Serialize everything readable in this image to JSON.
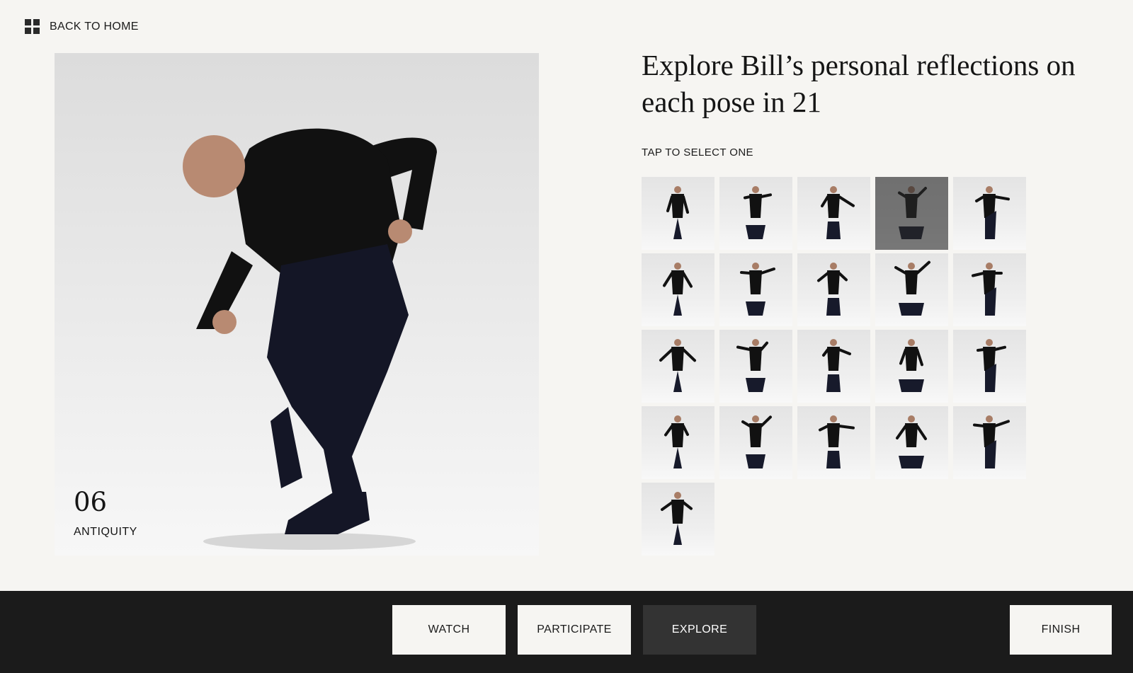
{
  "nav": {
    "back_label": "BACK TO HOME"
  },
  "hero": {
    "number": "06",
    "name": "ANTIQUITY"
  },
  "headline": "Explore Bill’s personal reflections on each pose in 21",
  "instruction": "TAP TO SELECT ONE",
  "poses": {
    "count": 21,
    "selected_index": 3
  },
  "footer": {
    "watch_label": "WATCH",
    "participate_label": "PARTICIPATE",
    "explore_label": "EXPLORE",
    "finish_label": "FINISH",
    "active": "EXPLORE"
  },
  "colors": {
    "background": "#f6f5f2",
    "footer": "#1b1b1b",
    "active_button": "#333333",
    "figure": "#111111"
  }
}
